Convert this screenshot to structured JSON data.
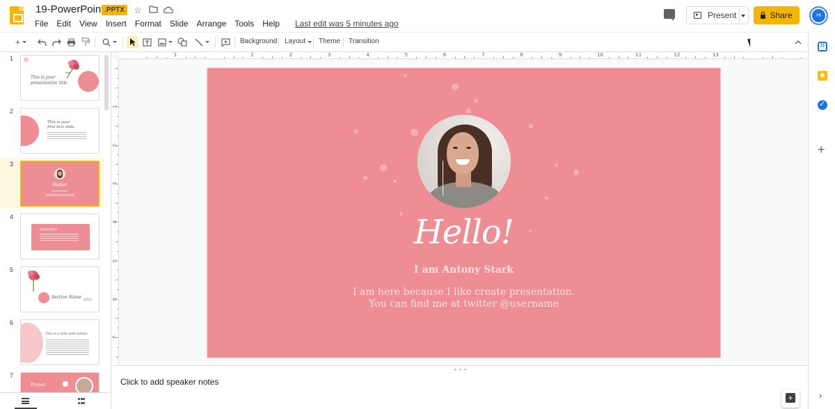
{
  "app": {
    "doc_title": "19-PowerPoint",
    "file_badge": ".PPTX",
    "last_edit": "Last edit was 5 minutes ago",
    "accent_color": "#f4b400"
  },
  "menu": [
    "File",
    "Edit",
    "View",
    "Insert",
    "Format",
    "Slide",
    "Arrange",
    "Tools",
    "Help"
  ],
  "header_buttons": {
    "present_label": "Present",
    "share_label": "Share"
  },
  "toolbar": {
    "background_label": "Background",
    "layout_label": "Layout",
    "theme_label": "Theme",
    "transition_label": "Transition"
  },
  "ruler": {
    "horizontal": [
      "1",
      "1",
      "2",
      "3",
      "4",
      "5",
      "6",
      "7",
      "8",
      "9",
      "10",
      "11",
      "12",
      "13"
    ],
    "vertical": [
      "1",
      "2",
      "3",
      "4",
      "5",
      "6",
      "7"
    ]
  },
  "slides": [
    {
      "number": "1",
      "title": "This is your presentation title"
    },
    {
      "number": "2",
      "title": "This is your first text slide"
    },
    {
      "number": "3",
      "title": "Hello!",
      "selected": true
    },
    {
      "number": "4",
      "title": "Quotation"
    },
    {
      "number": "5",
      "title": "Section Name"
    },
    {
      "number": "6",
      "title": "This is a slide with bullets"
    },
    {
      "number": "7",
      "title": "Project"
    }
  ],
  "current_slide": {
    "background_color": "#ee8d93",
    "heading": "Hello!",
    "name": "I am Antony Stark",
    "description_line1": "I am here because I like create presentation.",
    "description_line2": "You can find me at twitter @username"
  },
  "notes": {
    "placeholder": "Click to add speaker notes"
  }
}
